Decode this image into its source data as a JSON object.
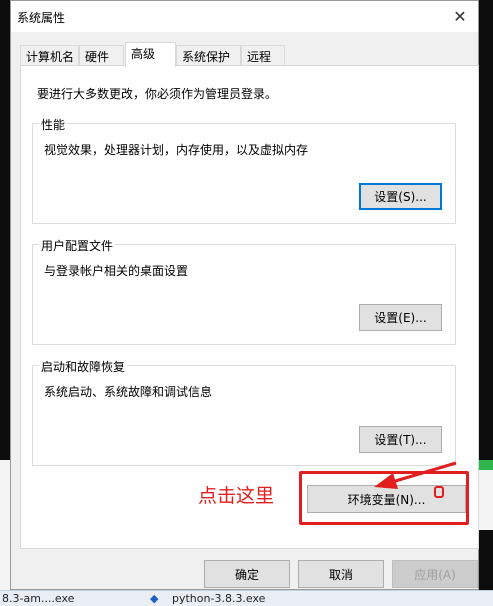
{
  "window": {
    "title": "系统属性",
    "close_symbol": "✕"
  },
  "tabs": [
    {
      "label": "计算机名"
    },
    {
      "label": "硬件"
    },
    {
      "label": "高级"
    },
    {
      "label": "系统保护"
    },
    {
      "label": "远程"
    }
  ],
  "active_tab": "高级",
  "intro_text": "要进行大多数更改，你必须作为管理员登录。",
  "groups": {
    "performance": {
      "label": "性能",
      "description": "视觉效果，处理器计划，内存使用，以及虚拟内存",
      "button": "设置(S)..."
    },
    "user_profiles": {
      "label": "用户配置文件",
      "description": "与登录帐户相关的桌面设置",
      "button": "设置(E)..."
    },
    "startup_recovery": {
      "label": "启动和故障恢复",
      "description": "系统启动、系统故障和调试信息",
      "button": "设置(T)..."
    }
  },
  "env_button": "环境变量(N)...",
  "footer": {
    "ok": "确定",
    "cancel": "取消",
    "apply": "应用(A)"
  },
  "annotation": {
    "text": "点击这里",
    "color": "#e21e1e"
  },
  "taskbar": {
    "item1": "8.3-am....exe",
    "item2": "python-3.8.3.exe"
  },
  "colors": {
    "focus": "#0078d7",
    "dialog_bg": "#f0f0f0",
    "panel_bg": "#ffffff"
  }
}
